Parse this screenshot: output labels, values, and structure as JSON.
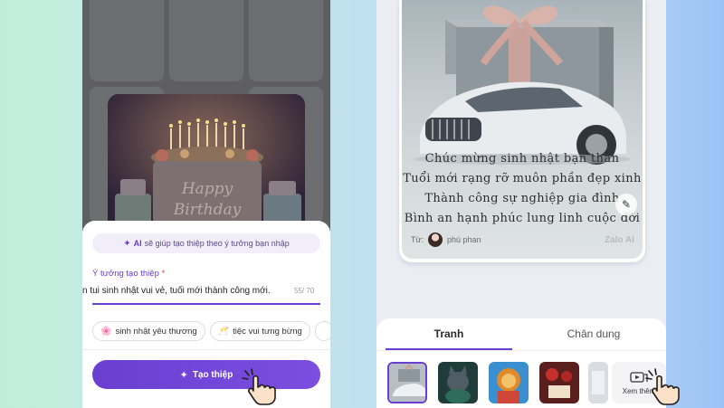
{
  "colors": {
    "accent": "#6a3fd0",
    "required": "#e0443e"
  },
  "left_screen": {
    "ai_hint": {
      "strong": "AI",
      "text": "sẽ giúp tạo thiệp theo ý tưởng bạn nhập"
    },
    "idea": {
      "label": "Ý tưởng tạo thiệp",
      "required_mark": "*",
      "value": "n tui sinh nhật vui vẻ, tuổi mới thành công mới.",
      "char_count": "55/ 70"
    },
    "suggestions": [
      {
        "emoji": "🌸",
        "label": "sinh nhật yêu thương"
      },
      {
        "emoji": "🥂",
        "label": "tiệc vui tưng bừng"
      }
    ],
    "create_button": {
      "label": "Tạo thiệp",
      "icon": "sparkle-icon"
    }
  },
  "right_screen": {
    "card": {
      "poem_lines": [
        "Chúc mừng sinh nhật bạn thân",
        "Tuổi mới rạng rỡ muôn phần đẹp xinh",
        "Thành công sự nghiệp gia đình",
        "Bình an hạnh phúc lung linh cuộc đời"
      ],
      "from_label": "Từ:",
      "author": "phú phan",
      "brand": "Zalo AI",
      "edit_icon": "pen-icon"
    },
    "tabs": [
      {
        "label": "Tranh",
        "active": true
      },
      {
        "label": "Chân dung",
        "active": false
      }
    ],
    "see_more_label": "Xem thêm",
    "thumbnail_icons": [
      "car-gift-thumbnail",
      "cat-thumbnail",
      "lion-thumbnail",
      "roses-thumbnail",
      "gift-thumbnail"
    ]
  }
}
